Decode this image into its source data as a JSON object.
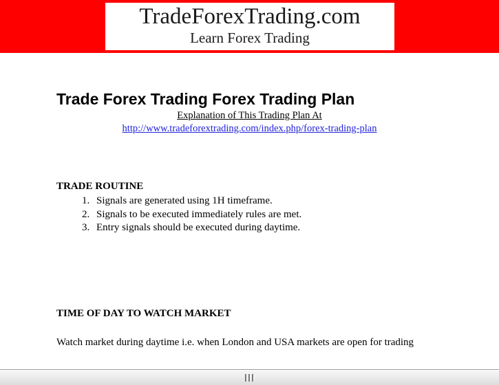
{
  "banner": {
    "background_color": "#ff0000",
    "logo": {
      "brand": "TradeForexTrading.com",
      "tagline": "Learn Forex Trading"
    }
  },
  "document": {
    "title": "Trade Forex Trading Forex Trading Plan",
    "explanation_label": "Explanation of This Trading Plan At",
    "explanation_url": "http://www.tradeforextrading.com/index.php/forex-trading-plan",
    "link_color": "#2222dd",
    "sections": [
      {
        "heading": "TRADE ROUTINE",
        "items": [
          "Signals are generated using 1H timeframe.",
          "Signals to be executed immediately rules are met.",
          "Entry signals should be executed during daytime."
        ]
      },
      {
        "heading": "TIME OF DAY TO WATCH MARKET",
        "paragraph": "Watch market during daytime i.e. when London and USA markets are open for trading"
      }
    ]
  },
  "chrome": {
    "splitter_name": "horizontal-splitter"
  }
}
